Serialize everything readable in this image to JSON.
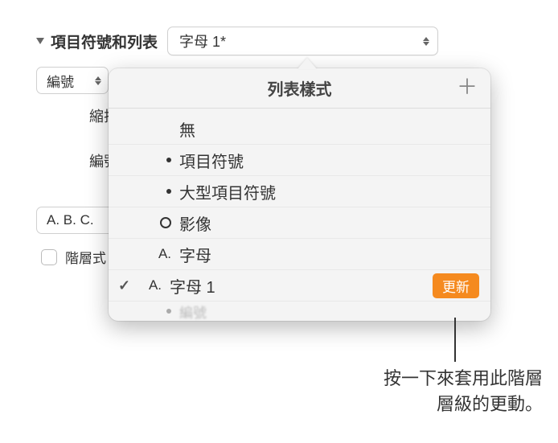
{
  "section": {
    "title": "項目符號和列表",
    "main_dropdown_value": "字母 1*"
  },
  "numbering_small": {
    "label": "編號"
  },
  "indent": {
    "label": "縮排"
  },
  "numbering": {
    "label": "編號"
  },
  "format_dropdown": {
    "value": "A. B. C."
  },
  "hierarchy_checkbox": {
    "label": "階層式"
  },
  "popover": {
    "title": "列表樣式",
    "items": {
      "none": "無",
      "bullet": "項目符號",
      "big_bullet": "大型項目符號",
      "image": "影像",
      "letter": "字母",
      "letter1": "字母 1",
      "marker_letter": "A.",
      "marker_truncated": "編號"
    },
    "update_btn": "更新"
  },
  "callout": {
    "line1": "按一下來套用此階層",
    "line2": "層級的更動。"
  }
}
